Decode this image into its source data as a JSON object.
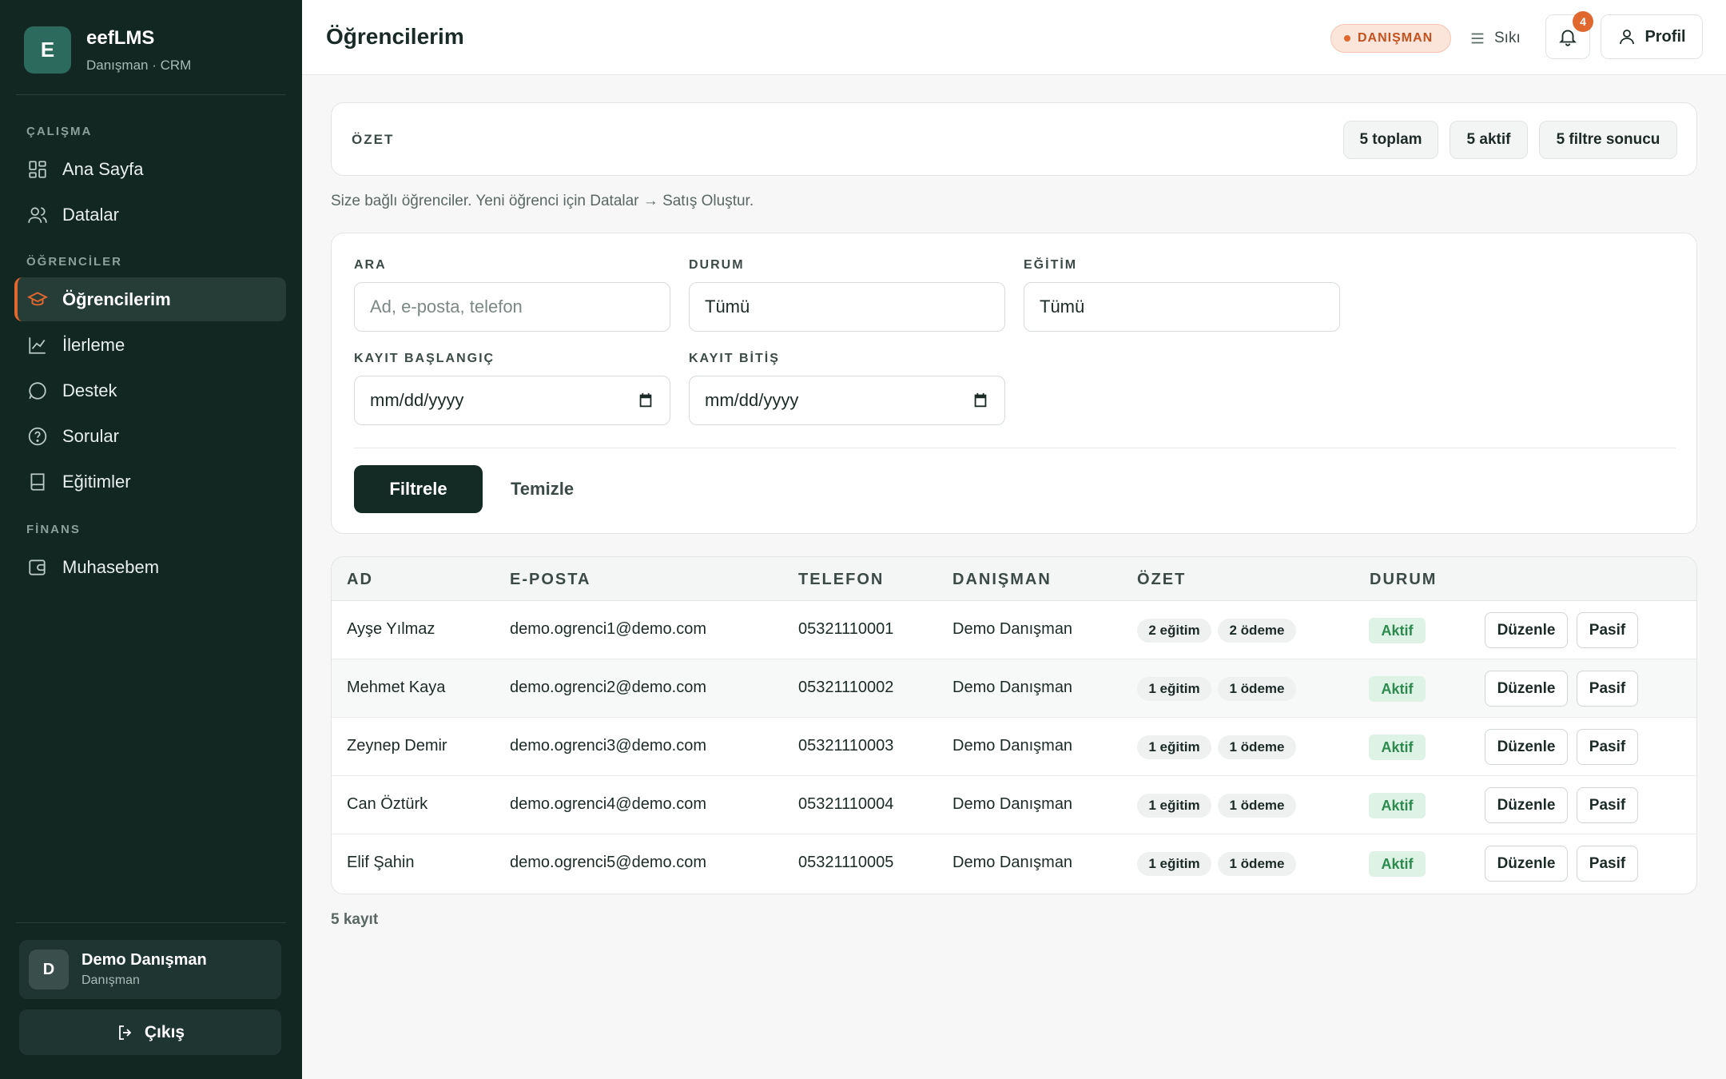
{
  "brand": {
    "logo_letter": "E",
    "name": "eefLMS",
    "subtitle": "Danışman · CRM"
  },
  "sidebar": {
    "sections": [
      {
        "label": "ÇALIŞMA"
      },
      {
        "label": "ÖĞRENCİLER"
      },
      {
        "label": "FİNANS"
      }
    ],
    "items": [
      {
        "label": "Ana Sayfa",
        "icon": "grid-icon"
      },
      {
        "label": "Datalar",
        "icon": "users-icon"
      },
      {
        "label": "Öğrencilerim",
        "icon": "graduation-cap-icon",
        "active": true
      },
      {
        "label": "İlerleme",
        "icon": "chart-icon"
      },
      {
        "label": "Destek",
        "icon": "chat-icon"
      },
      {
        "label": "Sorular",
        "icon": "help-icon"
      },
      {
        "label": "Eğitimler",
        "icon": "book-icon"
      },
      {
        "label": "Muhasebem",
        "icon": "wallet-icon"
      }
    ],
    "user": {
      "avatar_letter": "D",
      "name": "Demo Danışman",
      "role": "Danışman"
    },
    "logout_label": "Çıkış"
  },
  "header": {
    "title": "Öğrencilerim",
    "role_badge": "DANIŞMAN",
    "density_label": "Sıkı",
    "notification_count": "4",
    "profile_label": "Profil"
  },
  "summary": {
    "label": "ÖZET",
    "chips": [
      "5 toplam",
      "5 aktif",
      "5 filtre sonucu"
    ]
  },
  "helper_text": "Size bağlı öğrenciler. Yeni öğrenci için Datalar → Satış Oluştur.",
  "filters": {
    "search": {
      "label": "ARA",
      "placeholder": "Ad, e-posta, telefon"
    },
    "status": {
      "label": "DURUM",
      "value": "Tümü"
    },
    "education": {
      "label": "EĞİTİM",
      "value": "Tümü"
    },
    "start_date": {
      "label": "KAYIT BAŞLANGIÇ",
      "value": "mm/dd/yyyy"
    },
    "end_date": {
      "label": "KAYIT BİTİŞ",
      "value": "mm/dd/yyyy"
    },
    "filter_button": "Filtrele",
    "clear_button": "Temizle"
  },
  "table": {
    "columns": [
      "AD",
      "E-POSTA",
      "TELEFON",
      "DANIŞMAN",
      "ÖZET",
      "DURUM"
    ],
    "rows": [
      {
        "name": "Ayşe Yılmaz",
        "email": "demo.ogrenci1@demo.com",
        "phone": "05321110001",
        "advisor": "Demo Danışman",
        "education": "2 eğitim",
        "payment": "2 ödeme",
        "status": "Aktif"
      },
      {
        "name": "Mehmet Kaya",
        "email": "demo.ogrenci2@demo.com",
        "phone": "05321110002",
        "advisor": "Demo Danışman",
        "education": "1 eğitim",
        "payment": "1 ödeme",
        "status": "Aktif"
      },
      {
        "name": "Zeynep Demir",
        "email": "demo.ogrenci3@demo.com",
        "phone": "05321110003",
        "advisor": "Demo Danışman",
        "education": "1 eğitim",
        "payment": "1 ödeme",
        "status": "Aktif"
      },
      {
        "name": "Can Öztürk",
        "email": "demo.ogrenci4@demo.com",
        "phone": "05321110004",
        "advisor": "Demo Danışman",
        "education": "1 eğitim",
        "payment": "1 ödeme",
        "status": "Aktif"
      },
      {
        "name": "Elif Şahin",
        "email": "demo.ogrenci5@demo.com",
        "phone": "05321110005",
        "advisor": "Demo Danışman",
        "education": "1 eğitim",
        "payment": "1 ödeme",
        "status": "Aktif"
      }
    ],
    "edit_label": "Düzenle",
    "deactivate_label": "Pasif"
  },
  "record_count": "5 kayıt",
  "colors": {
    "sidebar_bg": "#122622",
    "accent": "#e0682e",
    "primary": "#132a25",
    "success": "#2c8a4f"
  }
}
